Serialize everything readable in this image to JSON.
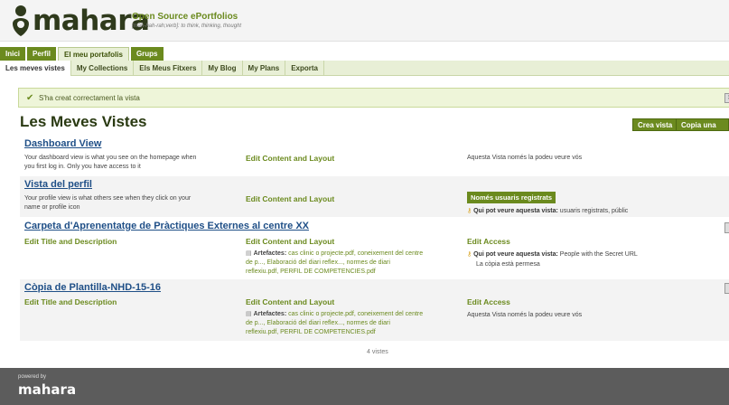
{
  "header": {
    "logo_text": "mahara",
    "tagline_title": "Open Source ePortfolios",
    "tagline_sub": "[mah-hah-rah;verb]: to think, thinking, thought"
  },
  "main_nav": [
    "Inici",
    "Perfil",
    "El meu portafolis",
    "Grups"
  ],
  "sub_nav": [
    "Les meves vistes",
    "My Collections",
    "Els Meus Fitxers",
    "My Blog",
    "My Plans",
    "Exporta"
  ],
  "message": "S'ha creat correctament la vista",
  "page_title": "Les Meves Vistes",
  "buttons": {
    "create": "Crea vista",
    "copy": "Copia una Vist"
  },
  "views": [
    {
      "title": "Dashboard View",
      "desc_line1": "Your dashboard view is what you see on the homepage when",
      "desc_line2": "you first log in. Only you have access to it",
      "edit_content": "Edit Content and Layout",
      "access": "Aquesta Vista només la podeu veure vós"
    },
    {
      "title": "Vista del perfil",
      "desc_line1": "Your profile view is what others see when they click on your",
      "desc_line2": "name or profile icon",
      "edit_content": "Edit Content and Layout",
      "badge": "Només usuaris registrats",
      "access_label": "Qui pot veure aquesta vista:",
      "access_value": "usuaris registrats, públic"
    },
    {
      "title": "Carpeta d'Aprenentatge de Pràctiques Externes al centre XX",
      "edit_title": "Edit Title and Description",
      "edit_content": "Edit Content and Layout",
      "artefacts_label": "Artefactes:",
      "artefacts_line1": "cas clinic o projecte.pdf, coneixement del centre",
      "artefacts_line2": "de p..., Elaboració del diari reflex..., normes de diari",
      "artefacts_line3": "reflexiu.pdf, PERFIL DE COMPETENCIES.pdf",
      "edit_access": "Edit Access",
      "access_label": "Qui pot veure aquesta vista:",
      "access_value": "People with the Secret URL",
      "access_extra": "La còpia està permesa"
    },
    {
      "title": "Còpia de Plantilla-NHD-15-16",
      "edit_title": "Edit Title and Description",
      "edit_content": "Edit Content and Layout",
      "artefacts_label": "Artefactes:",
      "artefacts_line1": "cas clinic o projecte.pdf, coneixement del centre",
      "artefacts_line2": "de p..., Elaboració del diari reflex..., normes de diari",
      "artefacts_line3": "reflexiu.pdf, PERFIL DE COMPETENCIES.pdf",
      "edit_access": "Edit Access",
      "access": "Aquesta Vista només la podeu veure vós"
    }
  ],
  "count": "4 vistes",
  "footer": {
    "powered": "powered by",
    "logo": "mahara"
  },
  "colors": {
    "brand_green": "#6b8a1e",
    "link_blue": "#1f4f87",
    "footer": "#5c5c5c"
  }
}
